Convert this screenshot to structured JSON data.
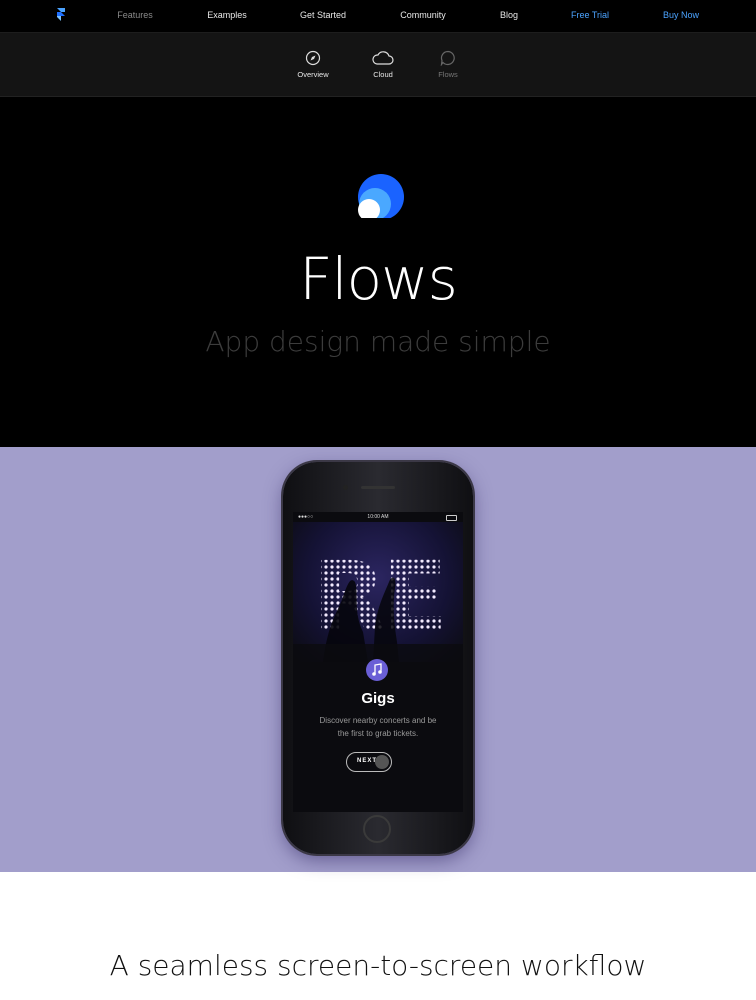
{
  "nav": {
    "items": [
      {
        "label": "Features",
        "color": "#8a8a8a"
      },
      {
        "label": "Examples",
        "color": "#e8e8e8"
      },
      {
        "label": "Get Started",
        "color": "#e8e8e8"
      },
      {
        "label": "Community",
        "color": "#e8e8e8"
      },
      {
        "label": "Blog",
        "color": "#e8e8e8"
      },
      {
        "label": "Free Trial",
        "color": "#4ba3ff"
      },
      {
        "label": "Buy Now",
        "color": "#4ba3ff"
      }
    ]
  },
  "subnav": {
    "items": [
      {
        "label": "Overview",
        "icon": "compass-icon"
      },
      {
        "label": "Cloud",
        "icon": "cloud-icon"
      },
      {
        "label": "Flows",
        "icon": "flows-icon"
      }
    ]
  },
  "hero": {
    "title": "Flows",
    "subtitle": "App design made simple"
  },
  "phone": {
    "time": "10:00 AM",
    "marquee": "RE",
    "card_title": "Gigs",
    "card_desc": "Discover nearby concerts and be the first to grab tickets.",
    "next_label": "NEXT"
  },
  "section": {
    "heading": "A seamless screen-to-screen workflow"
  },
  "colors": {
    "accent_blue": "#4ba3ff",
    "band_purple": "#a29ecb",
    "icon_purple": "#6a5fd6"
  }
}
